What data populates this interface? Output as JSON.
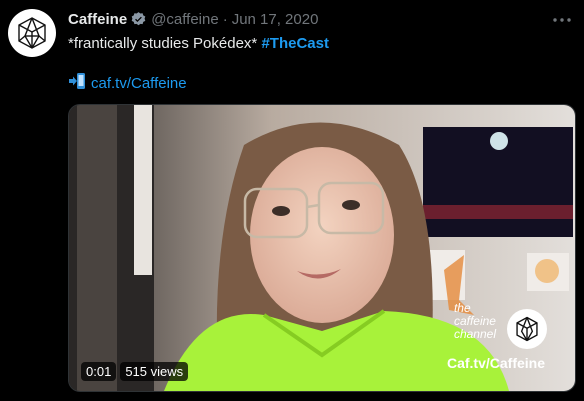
{
  "tweet": {
    "display_name": "Caffeine",
    "handle": "@caffeine",
    "separator": "·",
    "date": "Jun 17, 2020",
    "text_main": "*frantically studies Pokédex* ",
    "hashtag": "#TheCast",
    "link_text": "caf.tv/Caffeine"
  },
  "video": {
    "timestamp": "0:01",
    "views": "515 views",
    "watermark_line1": "the",
    "watermark_line2": "caffeine",
    "watermark_line3": "channel",
    "watermark_url": "Caf.tv/Caffeine"
  },
  "colors": {
    "link": "#1d9bf0",
    "verified": "#8b98a5"
  }
}
